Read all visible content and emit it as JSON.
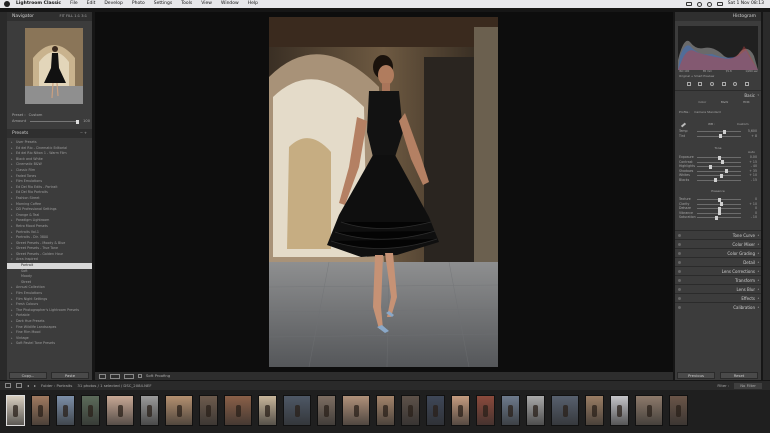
{
  "menubar": {
    "app_name": "Lightroom Classic",
    "items": [
      "File",
      "Edit",
      "Develop",
      "Photo",
      "Settings",
      "Tools",
      "View",
      "Window",
      "Help"
    ],
    "clock": "Sat 1 Nov  08:13"
  },
  "navigator": {
    "title": "Navigator",
    "options": "FIT  FILL  1:1  3:1"
  },
  "preset_info": {
    "preset_label": "Preset :",
    "preset_value": "Custom",
    "amount_label": "Amount",
    "amount_value": "100"
  },
  "presets": {
    "title": "Presets",
    "groups": [
      "User Presets",
      "Ed del Rio - Cinematic Editorial",
      "Ed del Rio Nikon 1 - Warm Film",
      "Black and White",
      "Cinematic B&W",
      "Classic Film",
      "Faded Tones",
      "Film Emulations",
      "Ed Del Rio Edits - Portrait",
      "Ed Del Rio Portraits",
      "Fashion Street",
      "Morning Coffee",
      "DD Professional Settings",
      "Orange & Teal",
      "Paradigm Lightroom",
      "Retro Mood Presets",
      "Portraits Vol.1",
      "Portraits - Dir. 3800",
      "Street Presets - Moody & Blue",
      "Street Presets - True Tone",
      "Street Presets - Golden Hour",
      "Area Inspired"
    ],
    "open_group": "Area Inspired",
    "open_items": [
      "Portrait",
      "Soft",
      "Moody",
      "Street"
    ],
    "groups_after": [
      "Annual Collection",
      "Film Emulations",
      "Film Night Settings",
      "Fresh Colours",
      "The Photographer's Lightroom Presets",
      "Portable",
      "Dark Hue Presets",
      "Fine Wildlife Landscapes",
      "Fine Film Mood",
      "Vintage",
      "Soft Pastel Tone Presets"
    ]
  },
  "left_buttons": {
    "copy": "Copy...",
    "paste": "Paste"
  },
  "toolbar": {
    "soft_proofing": "Soft Proofing"
  },
  "histogram": {
    "title": "Histogram",
    "meta": [
      "ISO 100",
      "85 mm",
      "f/1.8",
      "1/200 sec"
    ],
    "orig_label": "Original + Smart Preview"
  },
  "basic": {
    "title": "Basic",
    "treatment": [
      "Color",
      "B&W",
      "HDR"
    ],
    "profile_label": "Profile :",
    "profile_value": "Camera Standard",
    "wb_label": "WB :",
    "wb_value": "Custom",
    "rows_wb": [
      {
        "label": "Temp",
        "value": "5,600",
        "knob": 0.62
      },
      {
        "label": "Tint",
        "value": "+ 8",
        "knob": 0.53
      }
    ],
    "tone_label": "Tone",
    "tone_auto": "Auto",
    "rows_tone": [
      {
        "label": "Exposure",
        "value": "0.00",
        "knob": 0.5
      },
      {
        "label": "Contrast",
        "value": "+ 15",
        "knob": 0.58
      },
      {
        "label": "Highlights",
        "value": "- 40",
        "knob": 0.3
      },
      {
        "label": "Shadows",
        "value": "+ 35",
        "knob": 0.68
      },
      {
        "label": "Whites",
        "value": "+ 10",
        "knob": 0.55
      },
      {
        "label": "Blacks",
        "value": "- 15",
        "knob": 0.42
      }
    ],
    "presence_label": "Presence",
    "rows_presence": [
      {
        "label": "Texture",
        "value": "0",
        "knob": 0.5
      },
      {
        "label": "Clarity",
        "value": "+ 10",
        "knob": 0.55
      },
      {
        "label": "Dehaze",
        "value": "0",
        "knob": 0.5
      },
      {
        "label": "Vibrance",
        "value": "0",
        "knob": 0.5
      },
      {
        "label": "Saturation",
        "value": "- 10",
        "knob": 0.45
      }
    ]
  },
  "sections": [
    "Tone Curve",
    "Color Mixer",
    "Color Grading",
    "Detail",
    "Lens Corrections",
    "Transform",
    "Lens Blur",
    "Effects",
    "Calibration"
  ],
  "right_buttons": {
    "previous": "Previous",
    "reset": "Reset"
  },
  "filmbar": {
    "folder": "Folder : Portraits",
    "count": "31 photos / 1 selected / DSC_2084.NEF",
    "filter_label": "Filter :",
    "filter_value": "No Filter"
  },
  "colors": {
    "accent": "#2f5fd0",
    "panel": "#3c3c3c",
    "dark": "#161616"
  }
}
